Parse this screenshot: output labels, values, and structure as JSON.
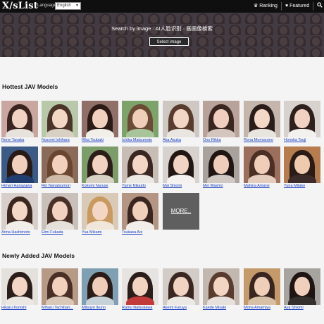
{
  "header": {
    "logo": "X/sList",
    "language_label": "Language:",
    "language_value": "English",
    "nav": {
      "ranking": "Ranking",
      "featured": "Featured"
    }
  },
  "hero": {
    "title": "Search by image · AI人脸识别 · 画画像検索",
    "button_label": "Select image"
  },
  "hottest": {
    "title": "Hottest JAV Models",
    "items": [
      {
        "name": "Nene Tanaka",
        "bg": "#c9a7a0",
        "hair": "#3a2420",
        "face": "#f0d3c3",
        "body": "#e7e2dc"
      },
      {
        "name": "Nozomi Ishihara",
        "bg": "#b8c9a9",
        "hair": "#4b3428",
        "face": "#f3d8c6",
        "body": "#d9d0c4"
      },
      {
        "name": "Rika Tsubaki",
        "bg": "#8f6f67",
        "hair": "#2b1a16",
        "face": "#f1d0bf",
        "body": "#f2efe8"
      },
      {
        "name": "Ichika Matsumoto",
        "bg": "#7da36a",
        "hair": "#6b4a36",
        "face": "#efcfb8",
        "body": "#a8c59a"
      },
      {
        "name": "Aka Asuka",
        "bg": "#cfc8c2",
        "hair": "#5a3c2f",
        "face": "#f2d6c6",
        "body": "#e9e6e2"
      },
      {
        "name": "Ono Rikka",
        "bg": "#b9a29a",
        "hair": "#3a2620",
        "face": "#f0cfc0",
        "body": "#d4c6bf"
      },
      {
        "name": "Rena Momozono",
        "bg": "#c4b5ad",
        "hair": "#2a1c18",
        "face": "#f3d7c7",
        "body": "#e8e4de"
      },
      {
        "name": "Honoka Tsuji",
        "bg": "#d8d2cf",
        "hair": "#2e201c",
        "face": "#f1d2c2",
        "body": "#f3f1ee"
      },
      {
        "name": "Himari Hanazawa",
        "bg": "#3b5a86",
        "hair": "#2a1a16",
        "face": "#f0cfbd",
        "body": "#1f3d6e"
      },
      {
        "name": "Riri Nanatsumori",
        "bg": "#8a6a58",
        "hair": "#6a4530",
        "face": "#f1d1bd",
        "body": "#cfb9a7"
      },
      {
        "name": "Kokomi Naruse",
        "bg": "#7c9c6a",
        "hair": "#2c1d19",
        "face": "#f2d3c1",
        "body": "#d8d2c4"
      },
      {
        "name": "Yume Nikaido",
        "bg": "#c7bdb5",
        "hair": "#3a2722",
        "face": "#f3d6c5",
        "body": "#ece8e3"
      },
      {
        "name": "Mai Shiomi",
        "bg": "#d7d2ce",
        "hair": "#231714",
        "face": "#f2d4c4",
        "body": "#f4f2ef"
      },
      {
        "name": "Mei Washio",
        "bg": "#a9a19c",
        "hair": "#1f1513",
        "face": "#efcdbb",
        "body": "#cfc8c3"
      },
      {
        "name": "Mahina Amane",
        "bg": "#9b6f5c",
        "hair": "#4a2f24",
        "face": "#f0cdb8",
        "body": "#e4cdbf"
      },
      {
        "name": "Yuna Mitake",
        "bg": "#b77c4d",
        "hair": "#2a1b17",
        "face": "#eecaae",
        "body": "#3b2c2a"
      },
      {
        "name": "Arina Hashimoto",
        "bg": "#d8cfca",
        "hair": "#3b2620",
        "face": "#f3d8c8",
        "body": "#f1ede9"
      },
      {
        "name": "Eimi Fukada",
        "bg": "#c9c0ba",
        "hair": "#4a3128",
        "face": "#f2d3c1",
        "body": "#e5e0da"
      },
      {
        "name": "Yua Mikami",
        "bg": "#d9c9b7",
        "hair": "#c99a5f",
        "face": "#f3d6c3",
        "body": "#f0e6da"
      },
      {
        "name": "Tsukasa Aoi",
        "bg": "#b49583",
        "hair": "#3a2520",
        "face": "#f0d0bd",
        "body": "#f2ede8"
      }
    ],
    "more_label": "MORE.."
  },
  "newly_added": {
    "title": "Newly Added JAV Models",
    "items": [
      {
        "name": "Hikaru Konishi",
        "bg": "#e4e0dc",
        "hair": "#2b1d19",
        "face": "#f2d5c4",
        "body": "#ebe8e4"
      },
      {
        "name": "Miharu Tachiban...",
        "bg": "#b79a86",
        "hair": "#4a2f26",
        "face": "#f1d0bd",
        "body": "#d9c7b8"
      },
      {
        "name": "Mitsuyo Ikuno",
        "bg": "#7f9fb2",
        "hair": "#2a1c18",
        "face": "#efcdb9",
        "body": "#c7d2d8"
      },
      {
        "name": "Ramu Natsukawa",
        "bg": "#e6e3e0",
        "hair": "#2b1d1a",
        "face": "#f2d4c3",
        "body": "#c23a3a"
      },
      {
        "name": "Akemi Furuya",
        "bg": "#d2cbc6",
        "hair": "#3a2722",
        "face": "#f1d3c2",
        "body": "#ece9e5"
      },
      {
        "name": "Kaede Misaki",
        "bg": "#c3b8b0",
        "hair": "#5a3c2f",
        "face": "#f2d5c3",
        "body": "#e6e1dc"
      },
      {
        "name": "Mona Amamiya",
        "bg": "#c49a6a",
        "hair": "#3a2620",
        "face": "#f0cfb9",
        "body": "#d8c0a6"
      },
      {
        "name": "Aya Shiomi",
        "bg": "#a7a39f",
        "hair": "#1f1513",
        "face": "#f0cfbd",
        "body": "#35302e"
      }
    ]
  }
}
